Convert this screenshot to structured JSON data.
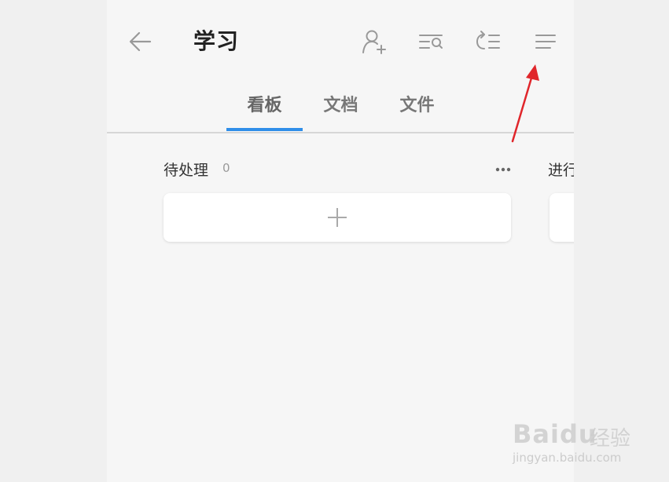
{
  "header": {
    "title": "学习",
    "icons": [
      "back-arrow-icon",
      "add-member-icon",
      "search-list-icon",
      "sort-list-icon",
      "menu-icon"
    ]
  },
  "tabs": [
    {
      "label": "看板",
      "active": true
    },
    {
      "label": "文档",
      "active": false
    },
    {
      "label": "文件",
      "active": false
    }
  ],
  "board": {
    "columns": [
      {
        "title": "待处理",
        "count": "0"
      },
      {
        "title": "进行"
      }
    ]
  },
  "colors": {
    "accent": "#2f8ee9",
    "annotation_arrow": "#e0262b"
  },
  "watermark": {
    "brand": "Baidu",
    "cn": "经验",
    "url": "jingyan.baidu.com"
  }
}
